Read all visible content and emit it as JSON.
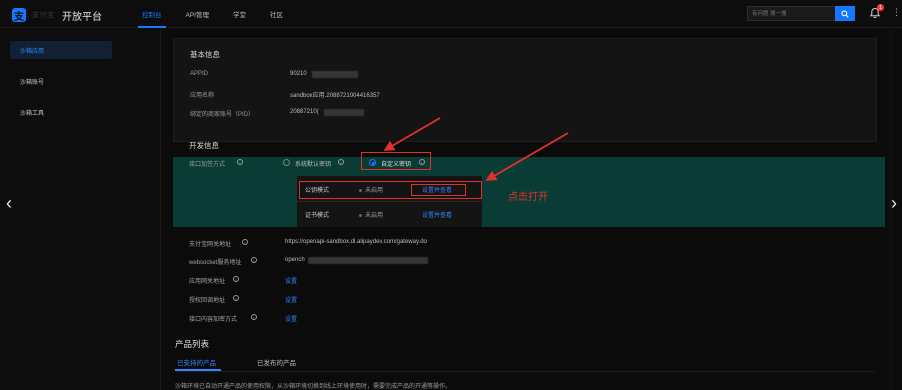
{
  "header": {
    "logo_text": "支付宝",
    "platform_title": "开放平台",
    "nav": [
      "控制台",
      "API管理",
      "学堂",
      "社区"
    ],
    "search_placeholder": "有问题 搜一搜",
    "notification_count": "1"
  },
  "sidebar": {
    "items": [
      "沙箱应用",
      "沙箱账号",
      "沙箱工具"
    ]
  },
  "basic_info": {
    "title": "基本信息",
    "fields": [
      {
        "label": "APPID",
        "value": "90210"
      },
      {
        "label": "应用名称",
        "value": "sandbox应用.2088721004416357"
      },
      {
        "label": "绑定的商家账号（PID）",
        "value": "20887210("
      }
    ]
  },
  "dev_info": {
    "title": "开发信息",
    "encrypt_label": "接口加签方式",
    "option_system": "系统默认密钥",
    "option_custom": "自定义密钥",
    "popup": {
      "rows": [
        {
          "mode": "公钥模式",
          "status": "未启用",
          "link": "设置并查看"
        },
        {
          "mode": "证书模式",
          "status": "未启用",
          "link": "设置并查看"
        }
      ]
    },
    "annotation": "点击打开",
    "addresses": [
      {
        "label": "支付宝网关地址",
        "value": "https://openapi-sandbox.dl.alipaydev.com/gateway.do"
      },
      {
        "label": "websocket服务地址",
        "value": "opench"
      },
      {
        "label": "应用网关地址",
        "value": "设置"
      },
      {
        "label": "授权回调地址",
        "value": "设置"
      },
      {
        "label": "接口内容加密方式",
        "value": "设置"
      }
    ]
  },
  "products": {
    "title": "产品列表",
    "tabs": [
      "已支持的产品",
      "已发布的产品"
    ],
    "notice": "沙箱环境已自动开通产品的使用权限，从沙箱环境切换到线上环境使用时，需要完成产品的开通等操作。"
  },
  "colors": {
    "accent": "#1677ff",
    "teal": "#0b3b35",
    "annotation_red": "#e0302b"
  }
}
